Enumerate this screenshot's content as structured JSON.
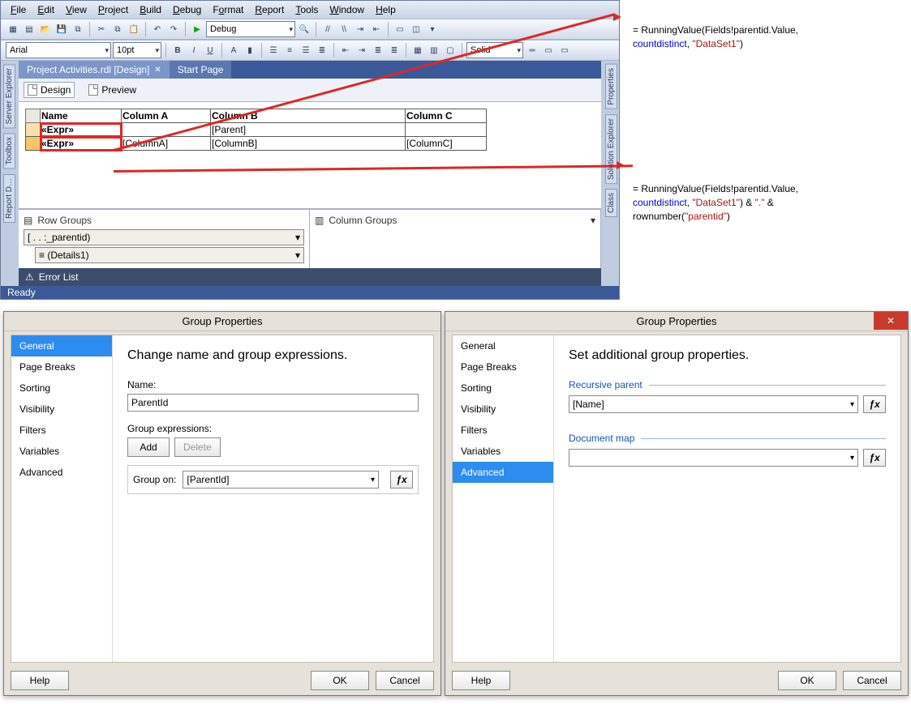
{
  "menubar": [
    "File",
    "Edit",
    "View",
    "Project",
    "Build",
    "Debug",
    "Format",
    "Report",
    "Tools",
    "Window",
    "Help"
  ],
  "toolbar1": {
    "config": "Debug"
  },
  "toolbar2": {
    "font": "Arial",
    "size": "10pt",
    "lineStyle": "Solid"
  },
  "leftDock": [
    "Server Explorer",
    "Toolbox",
    "Report D…"
  ],
  "rightDock": [
    "Properties",
    "Solution Explorer",
    "Class"
  ],
  "docTabs": [
    {
      "label": "Project Activities.rdl [Design]",
      "active": true
    },
    {
      "label": "Start Page",
      "active": false
    }
  ],
  "subTabs": {
    "design": "Design",
    "preview": "Preview"
  },
  "table": {
    "headers": [
      "Name",
      "Column A",
      "Column B",
      "Column C"
    ],
    "rows": [
      {
        "cells": [
          "«Expr»",
          "",
          "[Parent]",
          ""
        ],
        "selClass": "grp-sel-a"
      },
      {
        "cells": [
          "«Expr»",
          "[ColumnA]",
          "[ColumnB]",
          "[ColumnC]"
        ],
        "selClass": "grp-sel-b"
      }
    ]
  },
  "groupsPanel": {
    "rowTitle": "Row Groups",
    "colTitle": "Column Groups",
    "rowGroups": [
      "[ . . :_parentid)",
      "≡ (Details1)"
    ]
  },
  "errorList": "Error List",
  "status": "Ready",
  "code1": "= RunningValue(Fields!parentid.Value,\ncountdistinct, \"DataSet1\")",
  "code2": "= RunningValue(Fields!parentid.Value,\ncountdistinct, \"DataSet1\") & \".\" &\nrownumber(\"parentid\")",
  "dlgGeneral": {
    "title": "Group Properties",
    "nav": [
      "General",
      "Page Breaks",
      "Sorting",
      "Visibility",
      "Filters",
      "Variables",
      "Advanced"
    ],
    "heading": "Change name and group expressions.",
    "nameLabel": "Name:",
    "nameValue": "ParentId",
    "groupExprLabel": "Group expressions:",
    "addBtn": "Add",
    "deleteBtn": "Delete",
    "groupOnLabel": "Group on:",
    "groupOnValue": "[ParentId]",
    "help": "Help",
    "ok": "OK",
    "cancel": "Cancel"
  },
  "dlgAdvanced": {
    "title": "Group Properties",
    "heading": "Set additional group properties.",
    "recursiveLabel": "Recursive parent",
    "recursiveValue": "[Name]",
    "docmapLabel": "Document map",
    "docmapValue": "",
    "help": "Help",
    "ok": "OK",
    "cancel": "Cancel"
  }
}
